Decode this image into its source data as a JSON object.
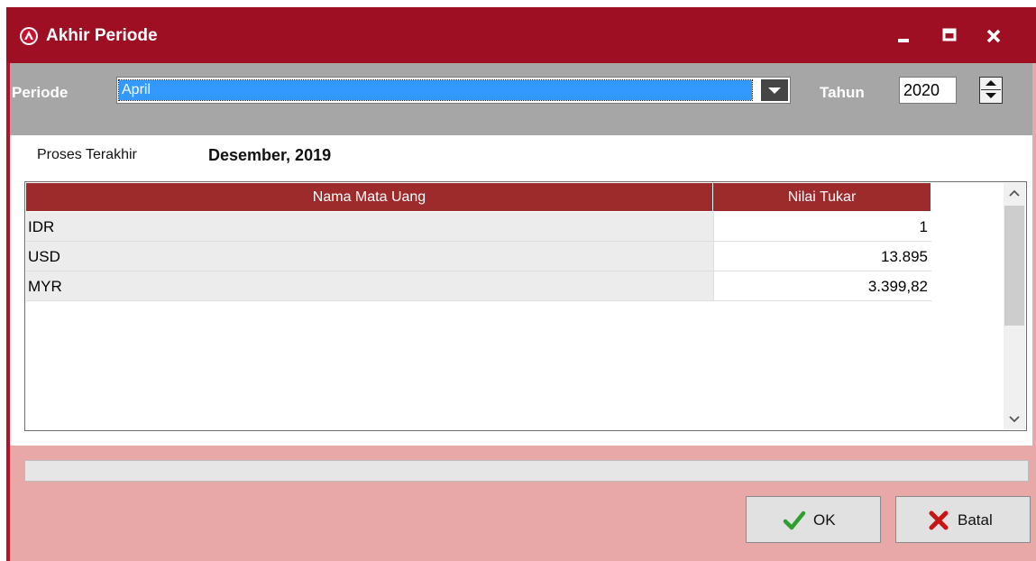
{
  "window": {
    "title": "Akhir Periode",
    "icon": "app-logo-icon",
    "controls": [
      "minimize-icon",
      "maximize-icon",
      "close-icon"
    ],
    "accent_color": "#9e0f24"
  },
  "toolbar": {
    "periode_label": "Periode",
    "periode_value": "April",
    "tahun_label": "Tahun",
    "tahun_value": "2020"
  },
  "status": {
    "proses_label": "Proses Terakhir",
    "proses_value": "Desember, 2019"
  },
  "grid": {
    "columns": [
      "Nama Mata Uang",
      "Nilai Tukar"
    ],
    "header_color": "#9e2b2b",
    "rows": [
      {
        "name": "IDR",
        "rate": "1"
      },
      {
        "name": "USD",
        "rate": "13.895"
      },
      {
        "name": "MYR",
        "rate": "3.399,82"
      }
    ]
  },
  "footer": {
    "ok_label": "OK",
    "batal_label": "Batal",
    "ok_icon": "checkmark-icon",
    "batal_icon": "cross-icon",
    "panel_color": "#e8a8a8"
  }
}
